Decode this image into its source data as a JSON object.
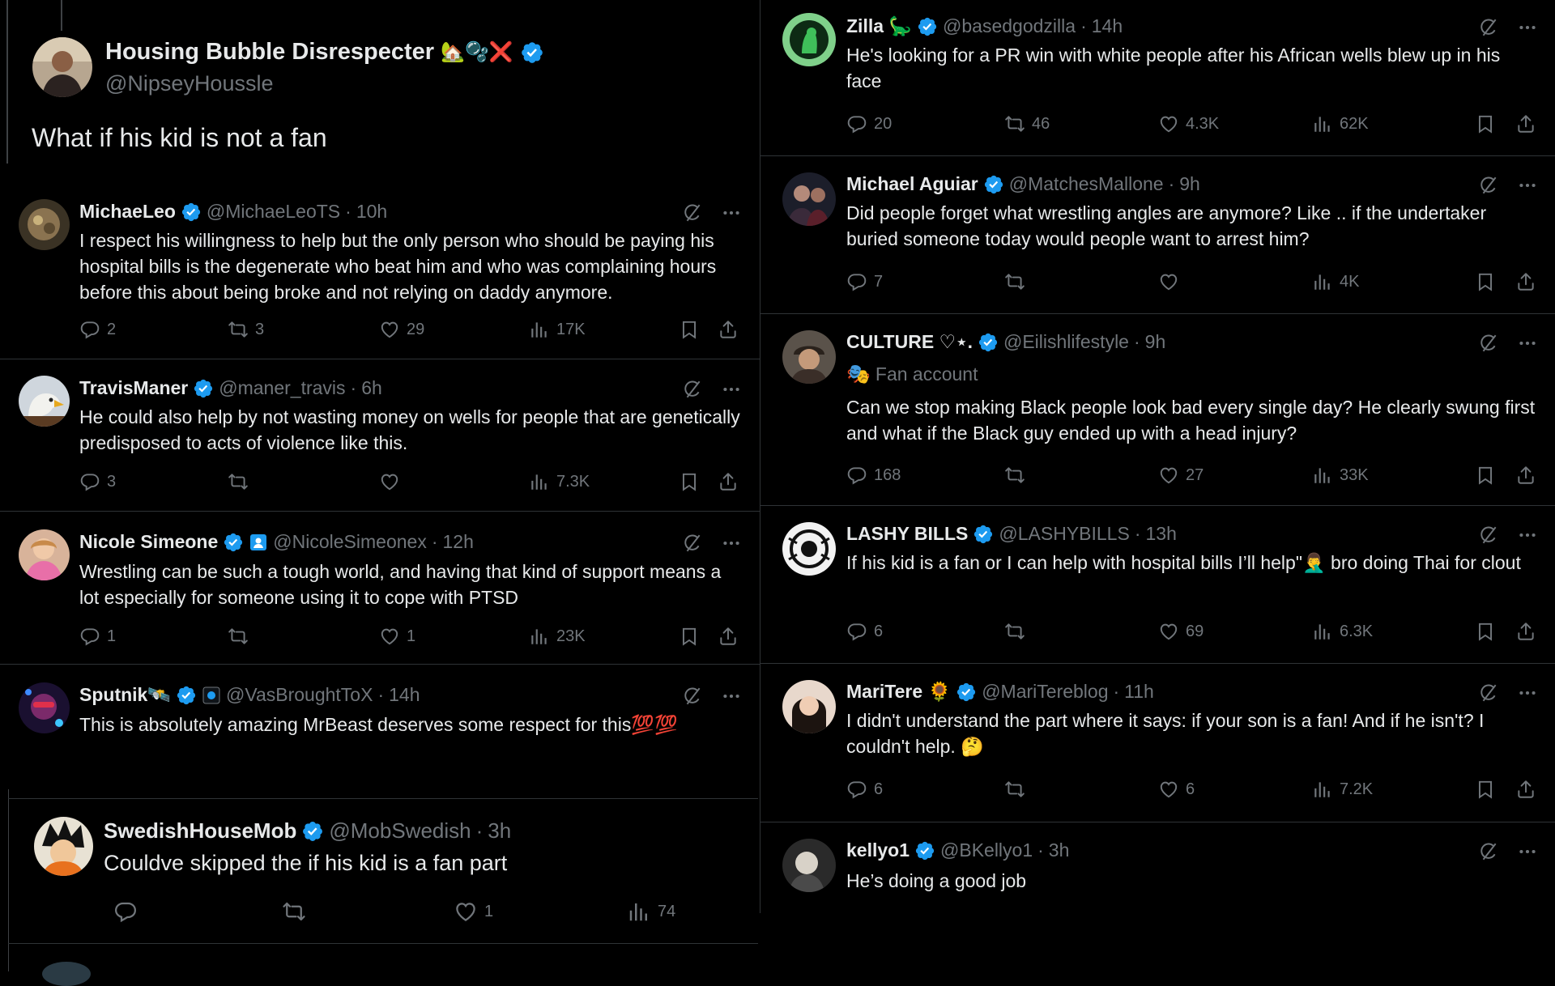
{
  "main": {
    "name": "Housing Bubble Disrespecter",
    "name_emoji": "🏡🫧❌",
    "handle": "@NipseyHoussle",
    "text": "What if his kid is not a fan"
  },
  "left_replies": [
    {
      "name": "MichaeLeo",
      "handle": "@MichaeLeoTS",
      "time": "10h",
      "text": "I respect his willingness to help but the only person who should be paying his hospital bills is the degenerate who beat him and who was complaining hours before this about being broke and not relying on daddy anymore.",
      "replies": "2",
      "reposts": "3",
      "likes": "29",
      "views": "17K"
    },
    {
      "name": "TravisManer",
      "handle": "@maner_travis",
      "time": "6h",
      "text": "He could also help by not wasting money on wells for people that are genetically predisposed to acts of violence like this.",
      "replies": "3",
      "reposts": "",
      "likes": "",
      "views": "7.3K"
    },
    {
      "name": "Nicole Simeone",
      "handle": "@NicoleSimeonex",
      "time": "12h",
      "text": "Wrestling can be such a tough world, and having that kind of support means a lot especially for someone using it to cope with PTSD",
      "replies": "1",
      "reposts": "",
      "likes": "1",
      "views": "23K"
    },
    {
      "name": "Sputnik🛰️",
      "handle": "@VasBroughtToX",
      "time": "14h",
      "text": "This is absolutely amazing MrBeast deserves some respect for this💯💯"
    },
    {
      "name": "SwedishHouseMob",
      "handle": "@MobSwedish",
      "time": "3h",
      "text": "Couldve skipped the if his kid is a fan part",
      "replies": "",
      "reposts": "",
      "likes": "1",
      "views": "74"
    }
  ],
  "right_replies": [
    {
      "name": "Zilla 🦕",
      "handle": "@basedgodzilla",
      "time": "14h",
      "text": "He's looking for a PR win with white people after his African wells blew up in his face",
      "replies": "20",
      "reposts": "46",
      "likes": "4.3K",
      "views": "62K"
    },
    {
      "name": "Michael Aguiar",
      "handle": "@MatchesMallone",
      "time": "9h",
      "text": "Did people forget what wrestling angles are anymore? Like .. if the undertaker buried someone today would people want to arrest him?",
      "replies": "7",
      "reposts": "",
      "likes": "",
      "views": "4K"
    },
    {
      "name": "CULTURE ♡⋆.",
      "handle": "@Eilishlifestyle",
      "time": "9h",
      "label_emoji": "🎭",
      "label": "Fan account",
      "text": "Can we stop making Black people look bad every single day? He clearly swung first and what if the Black guy ended up with a head injury?",
      "replies": "168",
      "reposts": "",
      "likes": "27",
      "views": "33K"
    },
    {
      "name": "LASHY BILLS",
      "handle": "@LASHYBILLS",
      "time": "13h",
      "text": "If his kid is a fan or I can help with hospital bills I’ll help\"🤦‍♂️ bro doing Thai for clout",
      "replies": "6",
      "reposts": "",
      "likes": "69",
      "views": "6.3K"
    },
    {
      "name": "MariTere 🌻",
      "handle": "@MariTereblog",
      "time": "11h",
      "text": "I didn't understand the part where it says: if your son is a fan! And if he isn't? I couldn't help. 🤔",
      "replies": "6",
      "reposts": "",
      "likes": "6",
      "views": "7.2K"
    },
    {
      "name": "kellyo1",
      "handle": "@BKellyo1",
      "time": "3h",
      "text": "He’s doing a good job"
    }
  ],
  "colors": {
    "verified": "#1d9bf0",
    "muted": "#71767b",
    "text": "#e7e9ea",
    "border": "#2f3336"
  }
}
